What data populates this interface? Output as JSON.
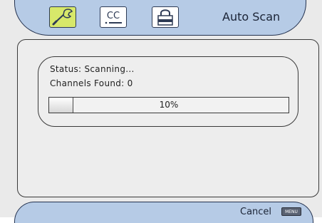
{
  "header": {
    "title": "Auto Scan",
    "tabs": [
      {
        "name": "setup",
        "icon": "wrench-icon",
        "active": true
      },
      {
        "name": "closed-captions",
        "label": "CC",
        "icon": "cc-icon",
        "active": false
      },
      {
        "name": "parental-lock",
        "icon": "lock-icon",
        "active": false
      }
    ]
  },
  "status": {
    "status_line": "Status:  Scanning...",
    "channels_line": "Channels Found: 0",
    "progress_value": 0.1,
    "progress_label": "10%"
  },
  "footer": {
    "cancel_label": "Cancel",
    "menu_key": "MENU"
  },
  "colors": {
    "bar_blue": "#b6cbe6",
    "active_tab": "#d7e86a",
    "outline": "#24324f"
  }
}
